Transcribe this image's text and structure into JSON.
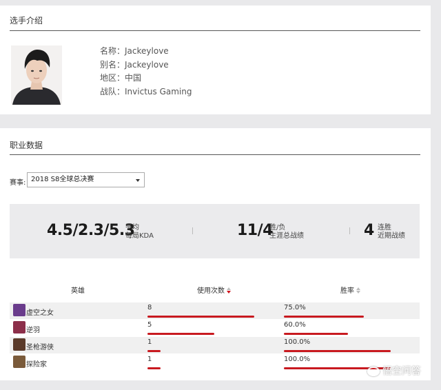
{
  "intro": {
    "title": "选手介绍",
    "fields": [
      {
        "key": "名称：",
        "value": "Jackeylove"
      },
      {
        "key": "别名：",
        "value": "Jackeylove"
      },
      {
        "key": "地区：",
        "value": "中国"
      },
      {
        "key": "战队：",
        "value": "Invictus Gaming"
      }
    ]
  },
  "career": {
    "title": "职业数据",
    "season_label": "赛事:",
    "season_selected": "2018 S8全球总决赛",
    "stats": {
      "kda_value": "4.5/2.3/5.3",
      "kda_label_1": "平均",
      "kda_label_2": "每局KDA",
      "record_value": "11/4",
      "record_label_1": "胜/负",
      "record_label_2": "生涯总战绩",
      "streak_value": "4",
      "streak_label_1": "连胜",
      "streak_label_2": "近期战绩"
    },
    "table": {
      "col_hero": "英雄",
      "col_uses": "使用次数",
      "col_winrate": "胜率",
      "rows": [
        {
          "hero": "虚空之女",
          "uses": "8",
          "winrate": "75.0%",
          "uses_fraction": 1.0,
          "winrate_fraction": 0.75,
          "icon_color": "#6a3c8c"
        },
        {
          "hero": "逆羽",
          "uses": "5",
          "winrate": "60.0%",
          "uses_fraction": 0.625,
          "winrate_fraction": 0.6,
          "icon_color": "#8c2f4a"
        },
        {
          "hero": "圣枪游侠",
          "uses": "1",
          "winrate": "100.0%",
          "uses_fraction": 0.125,
          "winrate_fraction": 1.0,
          "icon_color": "#5a3a2a"
        },
        {
          "hero": "探险家",
          "uses": "1",
          "winrate": "100.0%",
          "uses_fraction": 0.125,
          "winrate_fraction": 1.0,
          "icon_color": "#7a5a3a"
        }
      ]
    }
  },
  "watermark": "悟空问答",
  "colors": {
    "accent": "#c8191f",
    "panel": "#ebebed"
  }
}
